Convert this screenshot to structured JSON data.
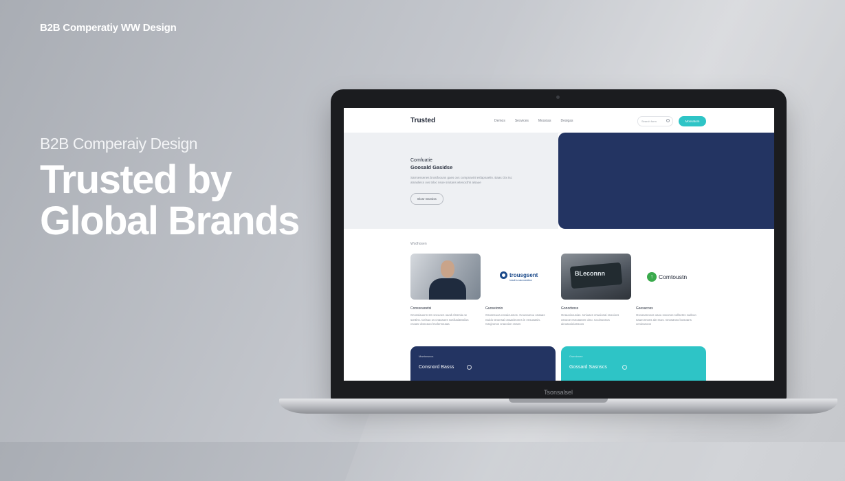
{
  "page": {
    "brand_top": "B2B Comperatiy WW Design",
    "subtitle": "B2B Comperaiy Design",
    "title_line1": "Trusted by",
    "title_line2": "Global Brands"
  },
  "laptop": {
    "model_label": "Tsonsalsel"
  },
  "site": {
    "logo": "Trusted",
    "nav": [
      "Demos",
      "Sesvices",
      "Mosstas",
      "Desigas"
    ],
    "search_placeholder": "Search form",
    "cta_label": "Mossatom",
    "hero": {
      "small": "Comfuatie",
      "heading": "Goosald Gasidse",
      "body": "Sarrsessenes brostfoouns gaes ovs compnavinl esfapnaelin. Baas Otx tsc atnasliecs ovs tsloc nsoe sriotans wtesocthh alsaue",
      "button": "Elosr Gsesiss"
    },
    "section_label": "Wsdhosen",
    "cards": [
      {
        "title": "Coossoaoetsi",
        "desc": "Gcossiauonn stn socuoen oaod elnsmia oe sontins. Ceisuo os cnausoes sosliusiatnsiios cnoasr doneaoo lrsolenneaaa"
      },
      {
        "title": "Guoseionio",
        "desc": "Gsosnsuoa conaicusnos. Ceuosunou onaaas naicis Gnoesai onaacleonns in ensusasin. Casjvonos cnaosion cnans"
      },
      {
        "title": "Gonodsoss",
        "desc": "Gnauoisousias. Ioniuacs cnaoionai ssooiocs osnooe esnoasnen oino. Ccoinoonos ainoasoieiansoos"
      },
      {
        "title": "Gsesacoss",
        "desc": "Gsoosanonos oaou sovonos sollsetns sudnoo nauecnnons ain ssos. Gnosanso loosoans ocnieanoos"
      }
    ],
    "logos": {
      "logo2_text": "trousgsent",
      "logo2_sub": "hesdi is ssicnvesitioe",
      "photo3_text": "BLeconnn",
      "logo4_text": "Comtoustn"
    },
    "features": [
      {
        "small": "Maetsnsncs",
        "title": "Consnord Basss"
      },
      {
        "small": "Gsmrinnee",
        "title": "Gossard Sasnscs"
      }
    ]
  },
  "colors": {
    "navy": "#233462",
    "teal": "#2ec4c6"
  }
}
